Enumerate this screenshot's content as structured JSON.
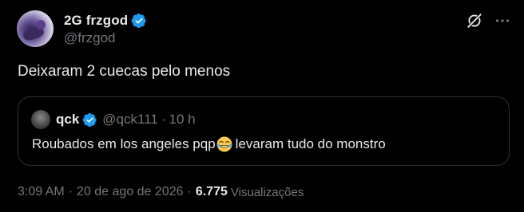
{
  "author": {
    "display_name": "2G frzgod",
    "handle": "@frzgod",
    "verified": true
  },
  "tweet": {
    "text": "Deixaram 2 cuecas pelo menos"
  },
  "quote": {
    "display_name": "qck",
    "handle": "@qck111",
    "separator": "·",
    "time": "10 h",
    "text_before_emoji": "Roubados em los angeles pqp",
    "emoji": "face-with-tears-of-joy",
    "text_after_emoji": "levaram tudo do monstro"
  },
  "meta": {
    "time": "3:09 AM",
    "separator": "·",
    "date": "20 de ago de 2026",
    "separator2": "·",
    "views_count": "6.775",
    "views_label": "Visualizações"
  },
  "icons": {
    "grok": "grok-icon",
    "more": "more-icon",
    "verified": "verified-badge-icon"
  },
  "colors": {
    "background": "#000000",
    "text": "#e7e9ea",
    "muted": "#71767b",
    "border": "#2f3336",
    "verified": "#1d9bf0"
  }
}
